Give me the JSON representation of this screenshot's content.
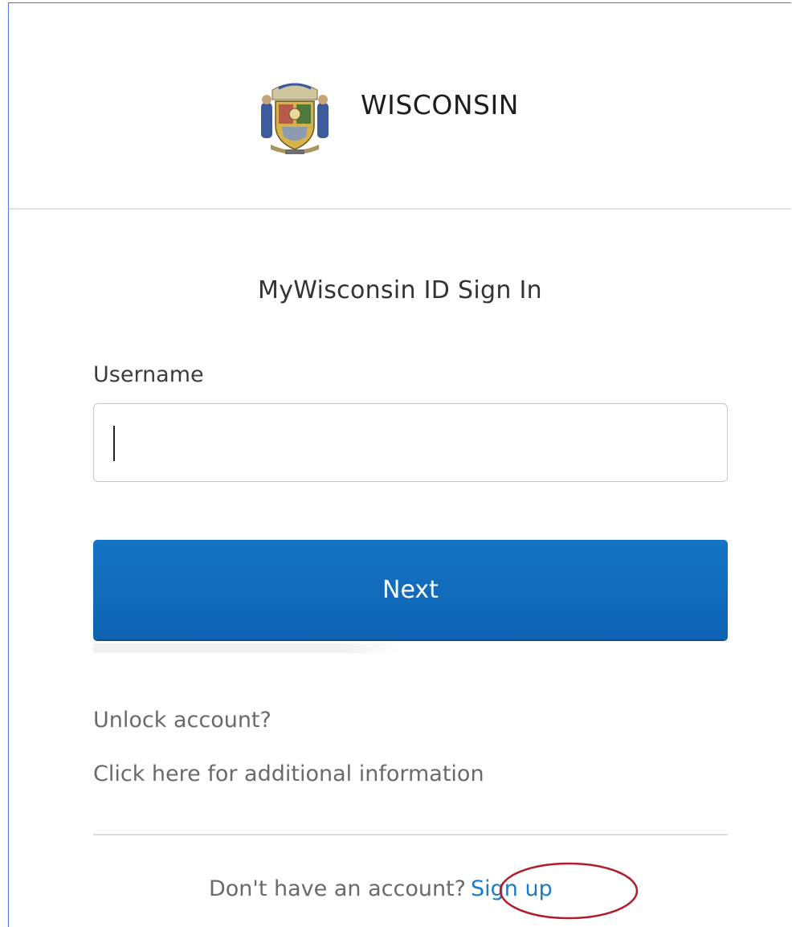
{
  "header": {
    "brand_name": "WISCONSIN",
    "seal_icon": "wisconsin-state-seal-icon"
  },
  "form": {
    "title": "MyWisconsin ID Sign In",
    "username_label": "Username",
    "username_value": "",
    "next_label": "Next"
  },
  "links": {
    "unlock": "Unlock account?",
    "more_info": "Click here for additional information"
  },
  "signup": {
    "prompt": "Don't have an account?",
    "link_label": "Sign up"
  },
  "colors": {
    "primary_button": "#1371c1",
    "link": "#1a7cc5",
    "highlight_annotation": "#b01c2e",
    "frame_border": "#4a7bd0"
  }
}
